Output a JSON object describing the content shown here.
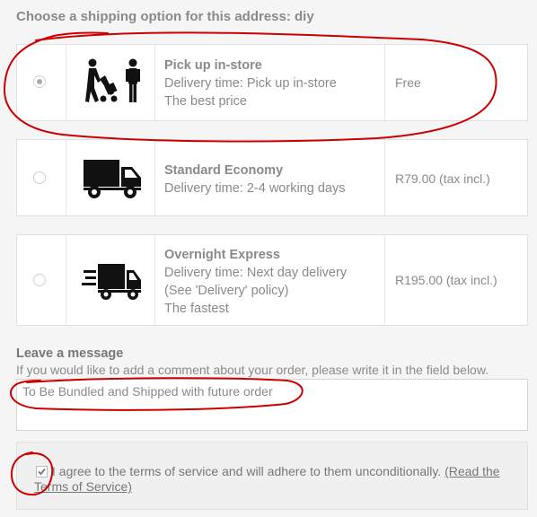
{
  "heading": "Choose a shipping option for this address: diy",
  "options": [
    {
      "name": "Pick up in-store",
      "delivery": "Delivery time: Pick up in-store",
      "extra": "The best price",
      "price": "Free",
      "selected": true,
      "icon": "pickup-person-icon"
    },
    {
      "name": "Standard Economy",
      "delivery": "Delivery time: 2-4 working days",
      "price": "R79.00 (tax incl.)",
      "selected": false,
      "icon": "truck-icon"
    },
    {
      "name": "Overnight Express",
      "delivery": "Delivery time: Next day delivery",
      "extra": "(See 'Delivery' policy)",
      "extra2": "The fastest",
      "price": "R195.00 (tax incl.)",
      "selected": false,
      "icon": "fast-truck-icon"
    }
  ],
  "message": {
    "heading": "Leave a message",
    "help": "If you would like to add a comment about your order, please write it in the field below.",
    "value": "To Be Bundled and Shipped with future order"
  },
  "terms": {
    "text": "I agree to the terms of service and will adhere to them unconditionally.",
    "link": "(Read the Terms of Service)",
    "checked": true
  },
  "colors": {
    "annotation": "#cc0000",
    "text": "#8a8a8a"
  }
}
